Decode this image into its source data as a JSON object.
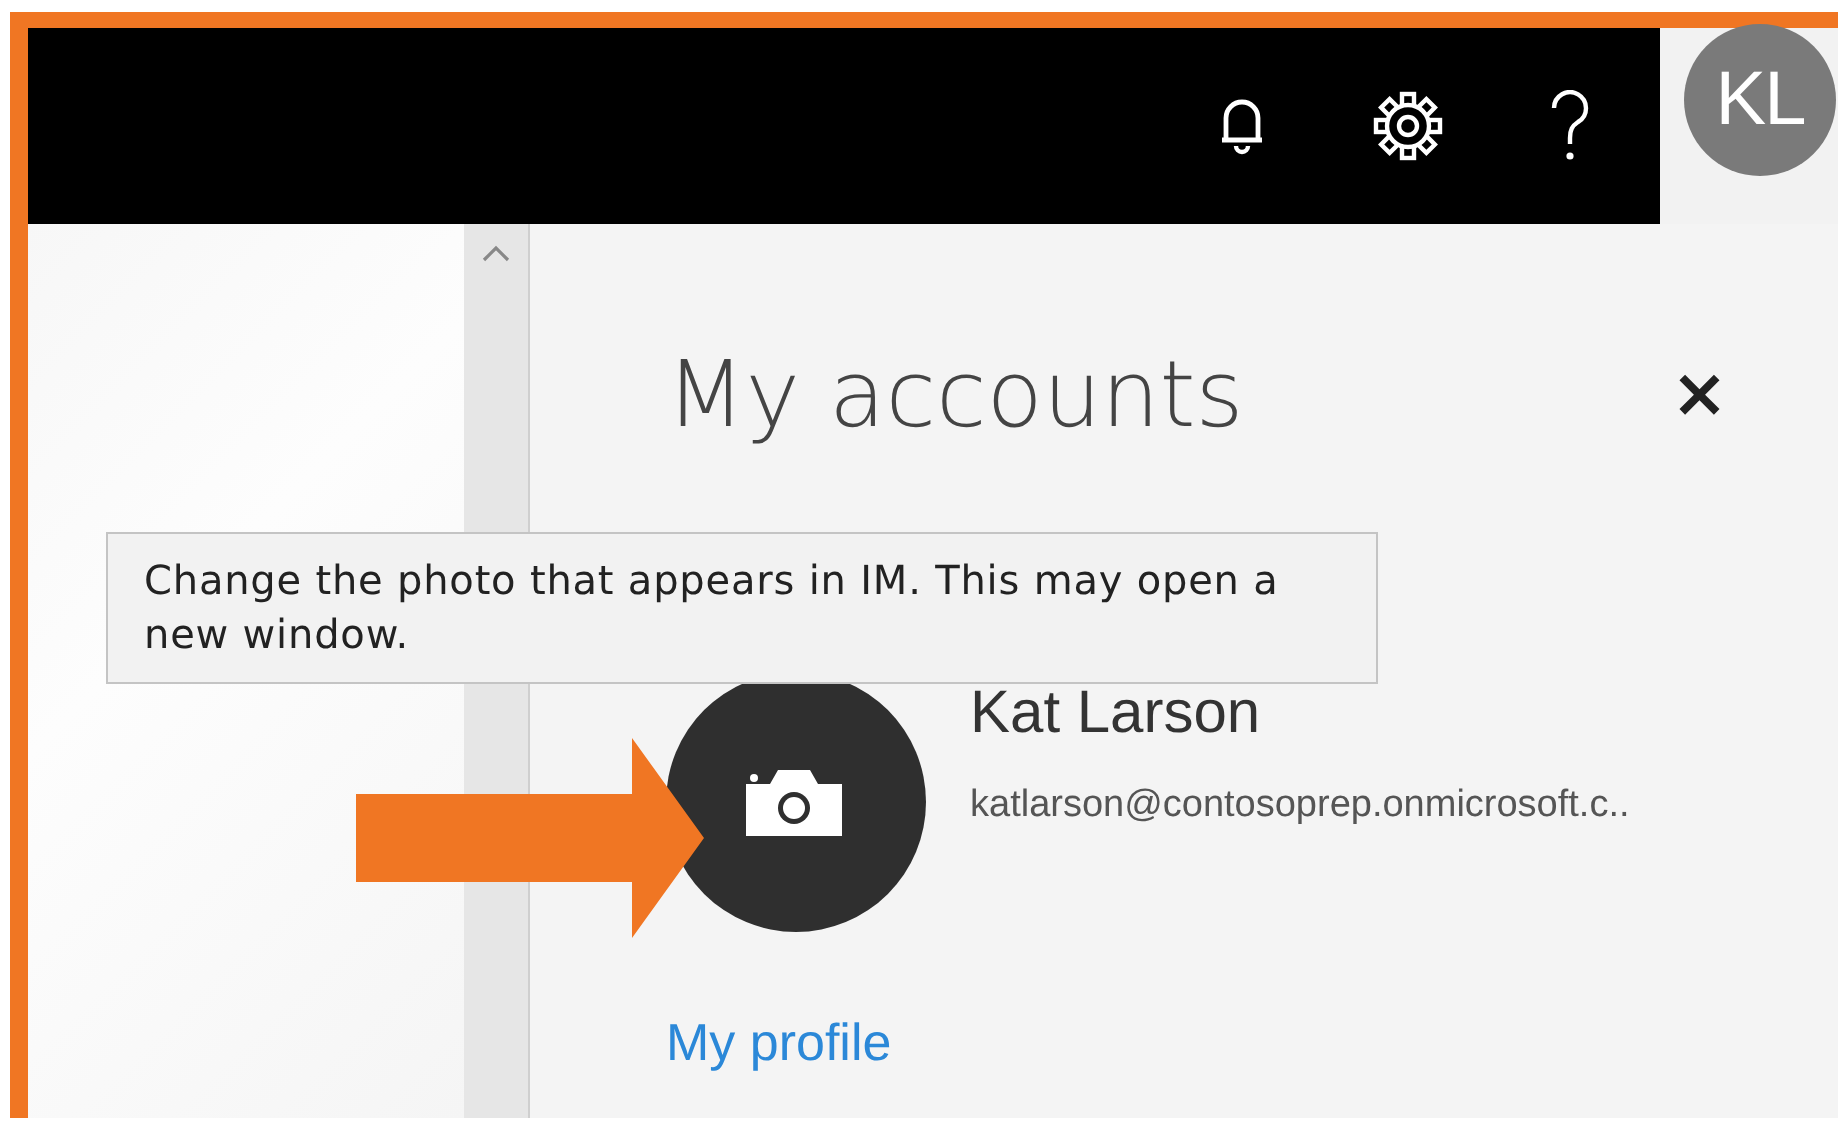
{
  "top_bar": {
    "account_initials": "KL"
  },
  "panel": {
    "title": "My accounts",
    "close": "×"
  },
  "tooltip": "Change the photo that appears in IM. This may open a new window.",
  "profile": {
    "name": "Kat Larson",
    "email": "katlarson@contosoprep.onmicrosoft.c..",
    "link": "My profile"
  }
}
